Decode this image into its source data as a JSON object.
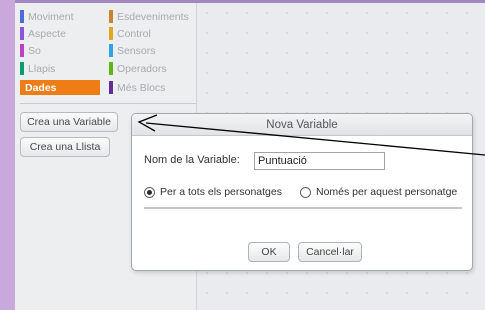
{
  "palette": {
    "categories": [
      {
        "label": "Moviment",
        "color": "#4a6cd4"
      },
      {
        "label": "Esdeveniments",
        "color": "#c88330"
      },
      {
        "label": "Aspecte",
        "color": "#8a55d7"
      },
      {
        "label": "Control",
        "color": "#e1a91a"
      },
      {
        "label": "So",
        "color": "#bb42c3"
      },
      {
        "label": "Sensors",
        "color": "#2ca5e2"
      },
      {
        "label": "Llapis",
        "color": "#0e9a6c"
      },
      {
        "label": "Operadors",
        "color": "#5cb712"
      },
      {
        "label": "Dades",
        "color": "#ee7d16",
        "selected": true
      },
      {
        "label": "Més Blocs",
        "color": "#632d99"
      }
    ],
    "make_variable_label": "Crea una Variable",
    "make_list_label": "Crea una Llista"
  },
  "dialog": {
    "title": "Nova Variable",
    "name_label": "Nom de la Variable:",
    "name_value": "Puntuació",
    "option_all": "Per a tots els personatges",
    "option_this": "Només per aquest personatge",
    "selected_option": "all",
    "ok_label": "OK",
    "cancel_label": "Cancel·lar"
  },
  "colors": {
    "data_category": "#ee7d16",
    "frame_purple": "#c9a9dc"
  }
}
